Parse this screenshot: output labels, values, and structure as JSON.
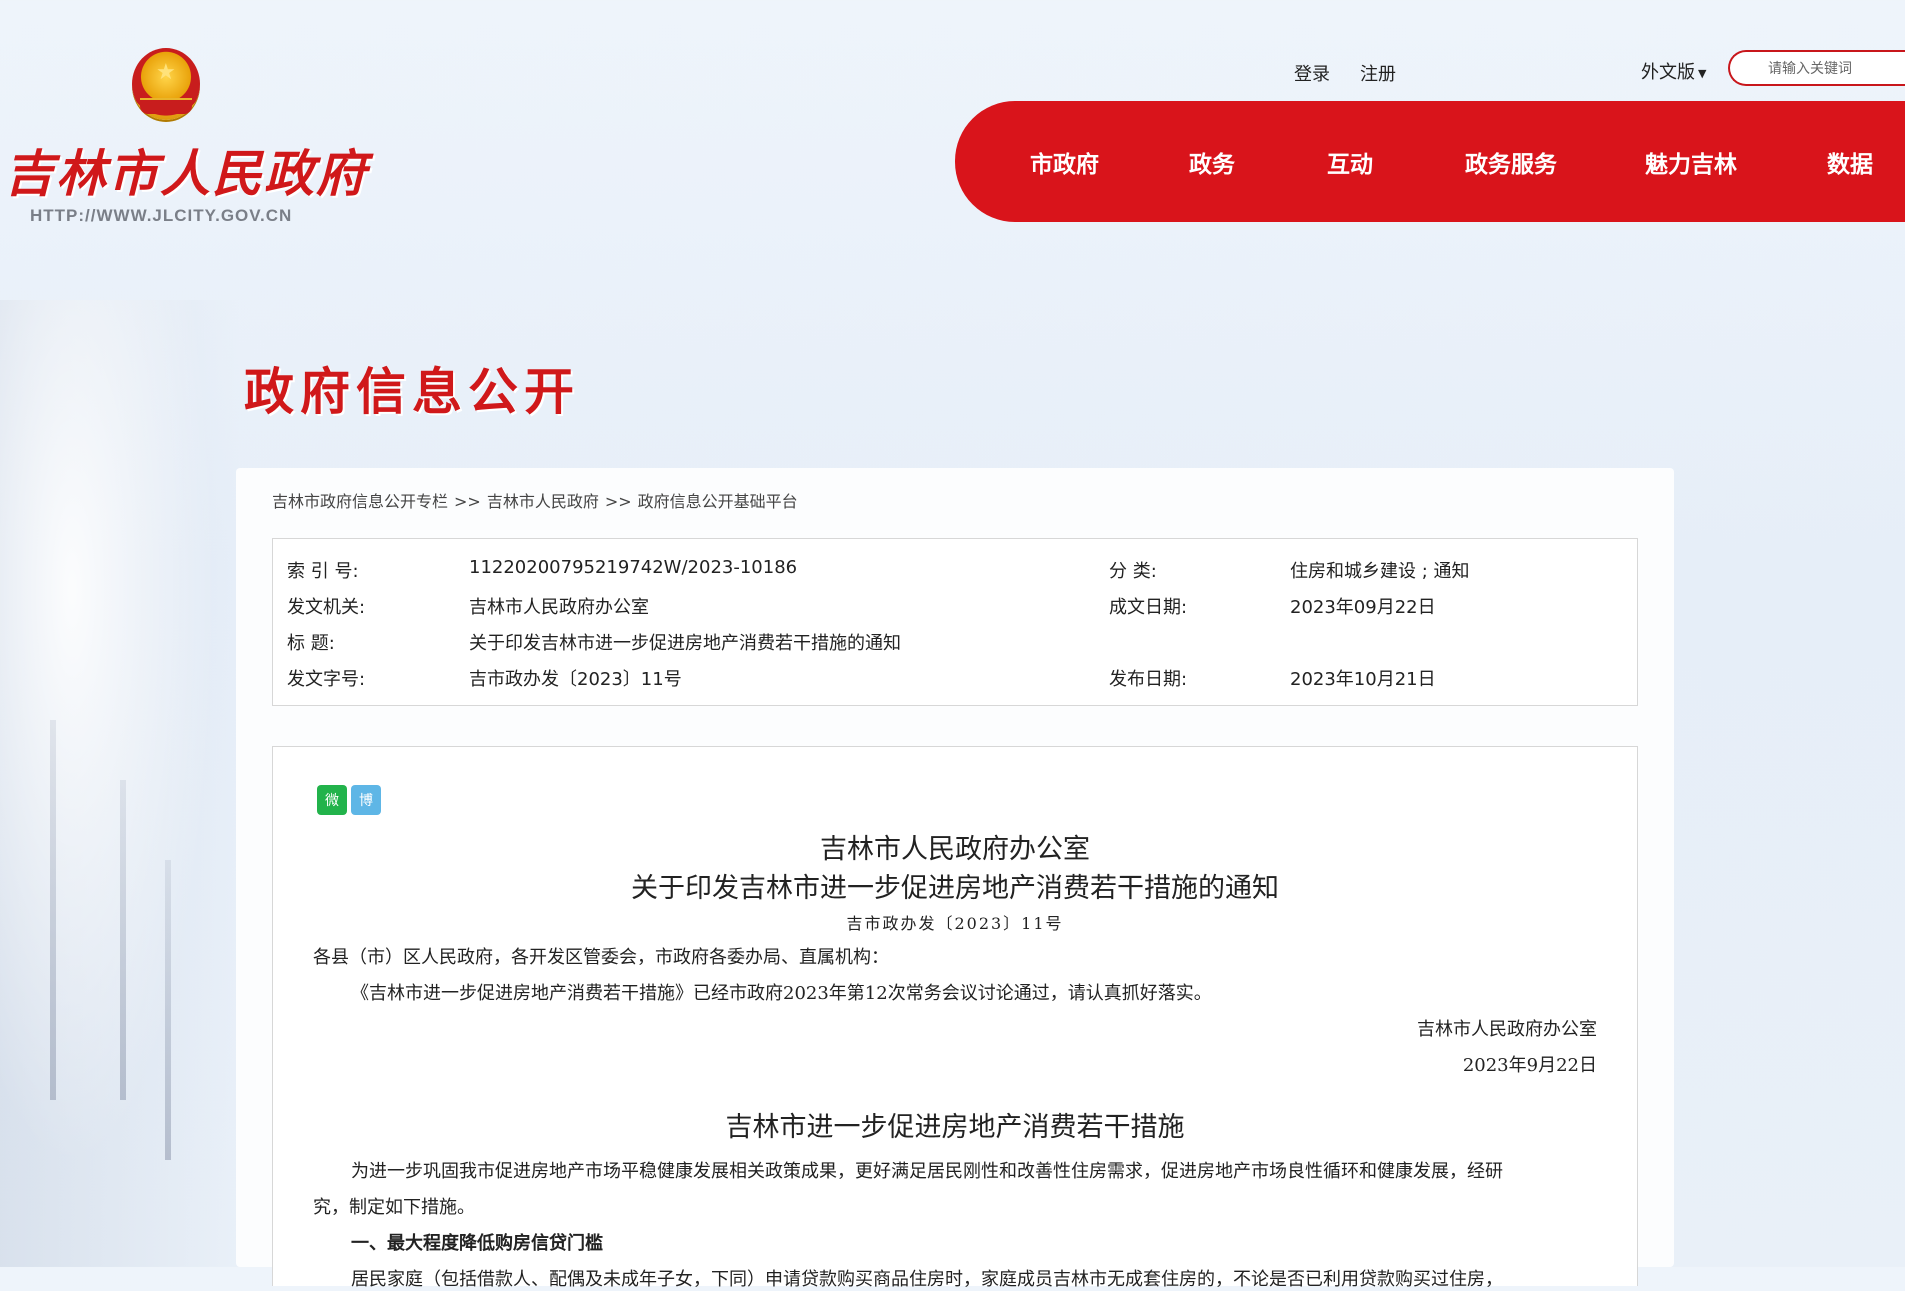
{
  "header": {
    "site_name": "吉林市人民政府",
    "site_url": "HTTP://WWW.JLCITY.GOV.CN",
    "login": "登录",
    "register": "注册",
    "language": "外文版",
    "search_placeholder": "请输入关键词"
  },
  "nav": {
    "items": [
      {
        "label": "市政府"
      },
      {
        "label": "政务"
      },
      {
        "label": "互动"
      },
      {
        "label": "政务服务"
      },
      {
        "label": "魅力吉林"
      },
      {
        "label": "数据"
      }
    ]
  },
  "section_title": "政府信息公开",
  "breadcrumb": {
    "items": [
      "吉林市政府信息公开专栏",
      "吉林市人民政府",
      "政府信息公开基础平台"
    ],
    "separator": ">>"
  },
  "meta": {
    "index_label": "索 引 号:",
    "index_value": "11220200795219742W/2023-10186",
    "category_label": "分    类:",
    "category_value": "住房和城乡建设 ; 通知",
    "issuer_label": "发文机关:",
    "issuer_value": "吉林市人民政府办公室",
    "created_label": "成文日期:",
    "created_value": "2023年09月22日",
    "title_label": "标     题:",
    "title_value": "关于印发吉林市进一步促进房地产消费若干措施的通知",
    "docno_label": "发文字号:",
    "docno_value": "吉市政办发〔2023〕11号",
    "published_label": "发布日期:",
    "published_value": "2023年10月21日"
  },
  "document": {
    "share_wechat": "微",
    "share_weibo": "博",
    "title_line1": "吉林市人民政府办公室",
    "title_line2": "关于印发吉林市进一步促进房地产消费若干措施的通知",
    "doc_number": "吉市政办发〔2023〕11号",
    "salutation": "各县（市）区人民政府，各开发区管委会，市政府各委办局、直属机构：",
    "body1": "《吉林市进一步促进房地产消费若干措施》已经市政府2023年第12次常务会议讨论通过，请认真抓好落实。",
    "signature": "吉林市人民政府办公室",
    "date": "2023年9月22日",
    "subtitle": "吉林市进一步促进房地产消费若干措施",
    "intro_line1": "为进一步巩固我市促进房地产市场平稳健康发展相关政策成果，更好满足居民刚性和改善性住房需求，促进房地产市场良性循环和健康发展，经研",
    "intro_line2": "究，制定如下措施。",
    "heading1": "一、最大程度降低购房信贷门槛",
    "para1": "居民家庭（包括借款人、配偶及未成年子女，下同）申请贷款购买商品住房时，家庭成员吉林市无成套住房的，不论是否已利用贷款购买过住房，"
  },
  "colors": {
    "brand_red": "#d9141b",
    "title_red": "#d0181a"
  }
}
